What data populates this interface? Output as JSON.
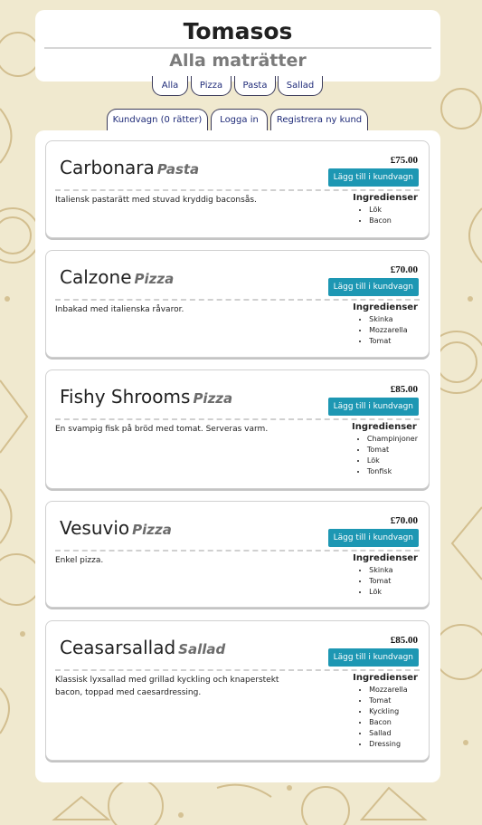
{
  "header": {
    "title": "Tomasos",
    "subtitle": "Alla maträtter"
  },
  "categories": [
    {
      "label": "Alla"
    },
    {
      "label": "Pizza"
    },
    {
      "label": "Pasta"
    },
    {
      "label": "Sallad"
    }
  ],
  "account_nav": {
    "cart_label": "Kundvagn (0 rätter)",
    "login_label": "Logga in",
    "register_label": "Registrera ny kund"
  },
  "dishes": [
    {
      "name": "Carbonara",
      "category": "Pasta",
      "price": "£75.00",
      "add_label": "Lägg till i kundvagn",
      "description": "Italiensk pastarätt med stuvad kryddig baconsås.",
      "ingredients_title": "Ingredienser",
      "ingredients": [
        "Lök",
        "Bacon"
      ]
    },
    {
      "name": "Calzone",
      "category": "Pizza",
      "price": "£70.00",
      "add_label": "Lägg till i kundvagn",
      "description": "Inbakad med italienska råvaror.",
      "ingredients_title": "Ingredienser",
      "ingredients": [
        "Skinka",
        "Mozzarella",
        "Tomat"
      ]
    },
    {
      "name": "Fishy Shrooms",
      "category": "Pizza",
      "price": "£85.00",
      "add_label": "Lägg till i kundvagn",
      "description": "En svampig fisk på bröd med tomat. Serveras varm.",
      "ingredients_title": "Ingredienser",
      "ingredients": [
        "Champinjoner",
        "Tomat",
        "Lök",
        "Tonfisk"
      ]
    },
    {
      "name": "Vesuvio",
      "category": "Pizza",
      "price": "£70.00",
      "add_label": "Lägg till i kundvagn",
      "description": "Enkel pizza.",
      "ingredients_title": "Ingredienser",
      "ingredients": [
        "Skinka",
        "Tomat",
        "Lök"
      ]
    },
    {
      "name": "Ceasarsallad",
      "category": "Sallad",
      "price": "£85.00",
      "add_label": "Lägg till i kundvagn",
      "description": "Klassisk lyxsallad med grillad kyckling och knaperstekt bacon, toppad med caesardressing.",
      "ingredients_title": "Ingredienser",
      "ingredients": [
        "Mozzarella",
        "Tomat",
        "Kyckling",
        "Bacon",
        "Sallad",
        "Dressing"
      ]
    }
  ],
  "colors": {
    "background": "#f0e9cf",
    "doodle": "#c9b07a",
    "accent_button": "#1d97b3",
    "tab_text": "#1e2a78"
  }
}
